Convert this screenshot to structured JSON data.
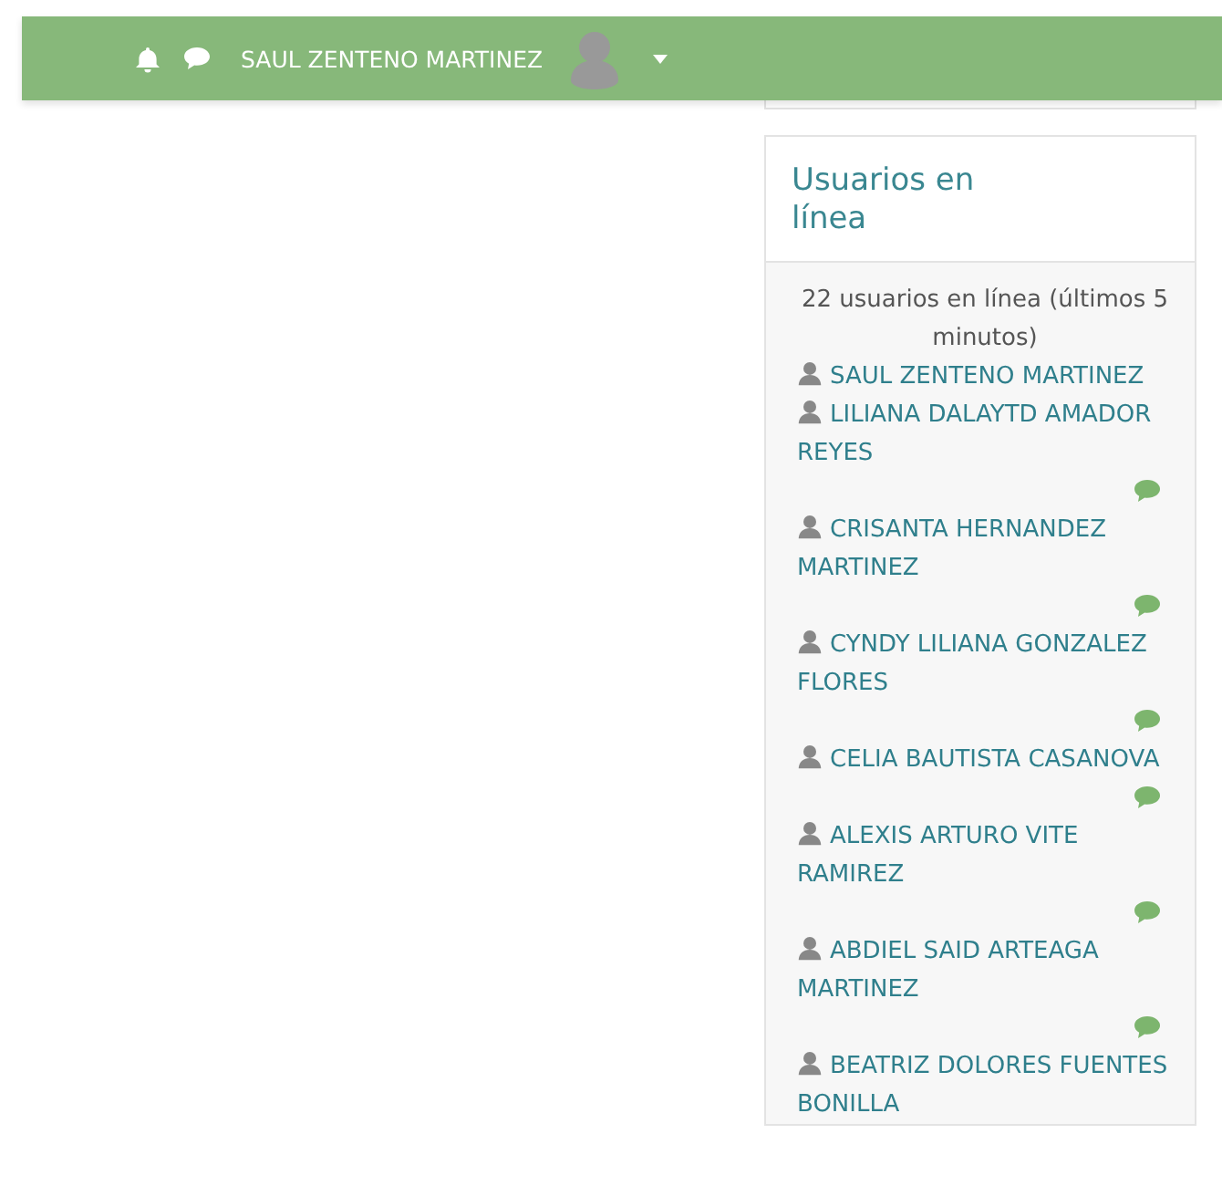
{
  "navbar": {
    "user_name": "SAUL ZENTENO MARTINEZ"
  },
  "online_users": {
    "title": "Usuarios en línea",
    "summary": "22 usuarios en línea (últimos 5 minutos)",
    "users": [
      {
        "name": "SAUL ZENTENO MARTINEZ",
        "message_icon": false
      },
      {
        "name": "LILIANA DALAYTD AMADOR REYES",
        "message_icon": true
      },
      {
        "name": "CRISANTA HERNANDEZ MARTINEZ",
        "message_icon": true
      },
      {
        "name": "CYNDY LILIANA GONZALEZ FLORES",
        "message_icon": true
      },
      {
        "name": "CELIA BAUTISTA CASANOVA",
        "message_icon": true
      },
      {
        "name": "ALEXIS ARTURO VITE RAMIREZ",
        "message_icon": true
      },
      {
        "name": "ABDIEL SAID ARTEAGA MARTINEZ",
        "message_icon": true
      },
      {
        "name": "BEATRIZ DOLORES FUENTES BONILLA",
        "message_icon": false
      }
    ]
  }
}
